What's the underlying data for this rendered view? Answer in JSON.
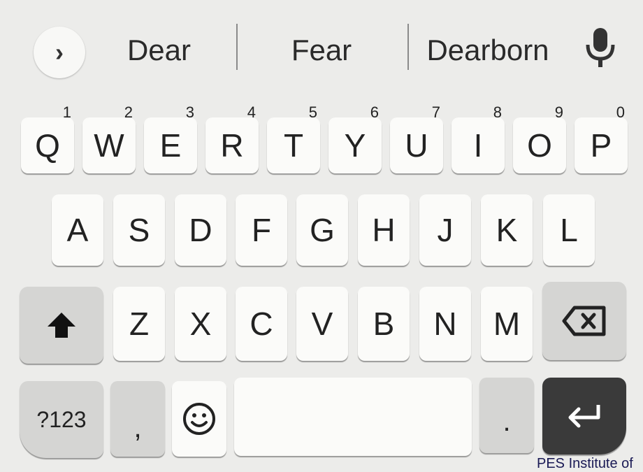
{
  "suggestions": {
    "expand_icon": "chevron-right-icon",
    "items": [
      "Dear",
      "Fear",
      "Dearborn"
    ],
    "mic_icon": "microphone-icon"
  },
  "keyboard": {
    "row1": [
      {
        "label": "Q",
        "hint": "1"
      },
      {
        "label": "W",
        "hint": "2"
      },
      {
        "label": "E",
        "hint": "3"
      },
      {
        "label": "R",
        "hint": "4"
      },
      {
        "label": "T",
        "hint": "5"
      },
      {
        "label": "Y",
        "hint": "6"
      },
      {
        "label": "U",
        "hint": "7"
      },
      {
        "label": "I",
        "hint": "8"
      },
      {
        "label": "O",
        "hint": "9"
      },
      {
        "label": "P",
        "hint": "0"
      }
    ],
    "row2": [
      "A",
      "S",
      "D",
      "F",
      "G",
      "H",
      "J",
      "K",
      "L"
    ],
    "row3": [
      "Z",
      "X",
      "C",
      "V",
      "B",
      "N",
      "M"
    ],
    "symbols_label": "?123",
    "comma_label": ",",
    "period_label": ".",
    "shift_icon": "shift-arrow-icon",
    "backspace_icon": "backspace-icon",
    "emoji_icon": "smiley-icon",
    "enter_icon": "enter-arrow-icon"
  },
  "watermark": "PES Institute of"
}
